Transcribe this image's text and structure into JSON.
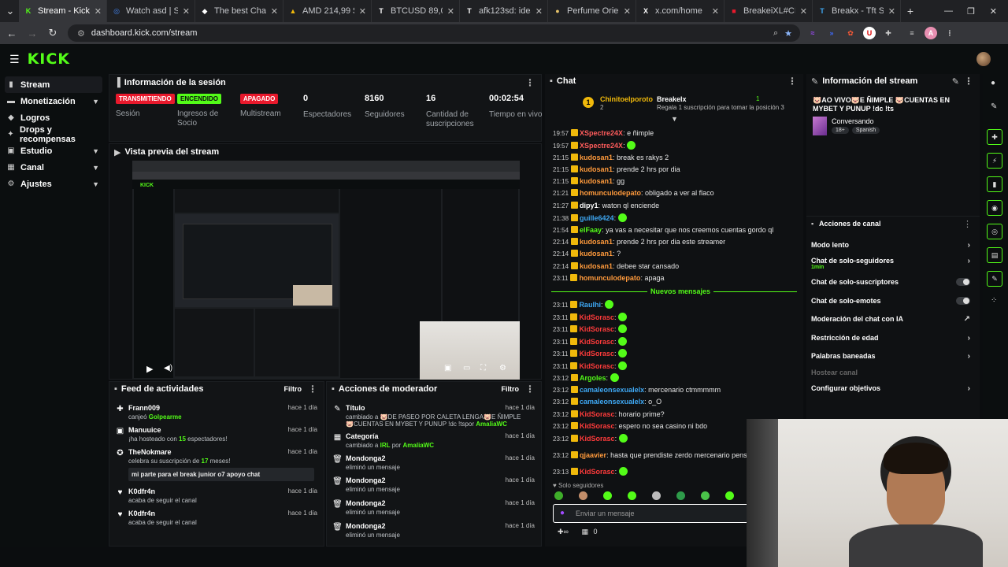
{
  "browser": {
    "tabs": [
      {
        "title": "Stream - Kick Dash",
        "color": "#53fc18",
        "glyph": "K",
        "active": true
      },
      {
        "title": "Watch asd | Strea",
        "color": "#4285f4",
        "glyph": "◎"
      },
      {
        "title": "The best ChatBot",
        "color": "#ffffff",
        "glyph": "◆"
      },
      {
        "title": "AMD 214,99 $ (▼",
        "color": "#f0b90b",
        "glyph": "▲"
      },
      {
        "title": "BTCUSD 89,093 ▲",
        "color": "#ffffff",
        "glyph": "T"
      },
      {
        "title": "afk123sd: ideas de",
        "color": "#ffffff",
        "glyph": "T"
      },
      {
        "title": "Perfume Oriental",
        "color": "#e6c36a",
        "glyph": "●"
      },
      {
        "title": "x.com/home",
        "color": "#ffffff",
        "glyph": "X"
      },
      {
        "title": "BreakeiXL#CIRDC",
        "color": "#e8192c",
        "glyph": "■"
      },
      {
        "title": "Breakx - Tft Stats",
        "color": "#3fa9f5",
        "glyph": "T"
      }
    ],
    "new_tab": "+",
    "url": "dashboard.kick.com/stream",
    "profile_letter": "A"
  },
  "kick": {
    "logo": "KICK"
  },
  "sidebar": {
    "items": [
      {
        "label": "Stream",
        "icon": "stream-icon",
        "glyph": "▮"
      },
      {
        "label": "Monetización",
        "icon": "money-icon",
        "glyph": "▬"
      },
      {
        "label": "Logros",
        "icon": "trophy-icon",
        "glyph": "◆"
      },
      {
        "label": "Drops y recompensas",
        "icon": "gift-icon",
        "glyph": "✦"
      },
      {
        "label": "Estudio",
        "icon": "studio-icon",
        "glyph": "▣"
      },
      {
        "label": "Canal",
        "icon": "channel-icon",
        "glyph": "▦"
      },
      {
        "label": "Ajustes",
        "icon": "gear-icon",
        "glyph": "⚙"
      }
    ]
  },
  "session": {
    "title": "Información de la sesión",
    "status": [
      {
        "badge": "TRANSMITIENDO",
        "label": "Sesión",
        "color": "red"
      },
      {
        "badge": "ENCENDIDO",
        "label": "Ingresos de Socio",
        "color": "green"
      },
      {
        "badge": "APAGADO",
        "label": "Multistream",
        "color": "red"
      }
    ],
    "stats": [
      {
        "value": "0",
        "label": "Espectadores"
      },
      {
        "value": "8160",
        "label": "Seguidores"
      },
      {
        "value": "16",
        "label": "Cantidad de suscripciones"
      },
      {
        "value": "00:02:54",
        "label": "Tiempo en vivo"
      }
    ]
  },
  "preview": {
    "title": "Vista previa del stream"
  },
  "activity": {
    "title": "Feed de actividades",
    "filter": "Filtro",
    "items": [
      {
        "name": "Frann009",
        "prefix": "canjeó ",
        "highlight": "Golpearme",
        "suffix": "",
        "when": "hace 1 día",
        "icon": "reward-icon"
      },
      {
        "name": "Manuuice",
        "prefix": "¡ha hosteado con ",
        "highlight": "15",
        "suffix": " espectadores!",
        "when": "hace 1 día",
        "icon": "host-icon"
      },
      {
        "name": "TheNokmare",
        "prefix": "celebra su suscripción de ",
        "highlight": "17",
        "suffix": " meses!",
        "when": "hace 1 día",
        "icon": "star-icon",
        "quote": "mi parte para el break junior o7 apoyo chat"
      },
      {
        "name": "K0dfr4n",
        "prefix": "acaba de seguir el canal",
        "highlight": "",
        "suffix": "",
        "when": "hace 1 día",
        "icon": "heart-icon"
      },
      {
        "name": "K0dfr4n",
        "prefix": "acaba de seguir el canal",
        "highlight": "",
        "suffix": "",
        "when": "hace 1 día",
        "icon": "heart-icon"
      }
    ]
  },
  "modactions": {
    "title": "Acciones de moderador",
    "filter": "Filtro",
    "items": [
      {
        "name": "Título",
        "desc": "cambiado a 🐷DE PASEO POR CALETA LENGA🐷E ÑIMPLE 🐷CUENTAS EN MYBET Y PUNUP !dc !ts",
        "by": "por ",
        "user": "AmaliaWC",
        "when": "hace 1 día",
        "icon": "title-icon"
      },
      {
        "name": "Categoría",
        "desc": "cambiado a ",
        "cat": "IRL",
        "by": " por ",
        "user": "AmaliaWC",
        "when": "hace 1 día",
        "icon": "category-icon"
      },
      {
        "name": "Mondonga2",
        "desc": "eliminó un mensaje",
        "when": "hace 1 día",
        "icon": "trash-icon"
      },
      {
        "name": "Mondonga2",
        "desc": "eliminó un mensaje",
        "when": "hace 1 día",
        "icon": "trash-icon"
      },
      {
        "name": "Mondonga2",
        "desc": "eliminó un mensaje",
        "when": "hace 1 día",
        "icon": "trash-icon"
      },
      {
        "name": "Mondonga2",
        "desc": "eliminó un mensaje",
        "when": "hace 1 día",
        "icon": "trash-icon"
      }
    ]
  },
  "chat": {
    "title": "Chat",
    "pinned": {
      "rank": "1",
      "user": "Chinitoelporoto",
      "count": "2",
      "target": "Breakelx",
      "target_count": "1",
      "text": "Regala 1 suscripción para tomar la posición 3"
    },
    "messages": [
      {
        "time": "19:57",
        "user": "XSpectre24X",
        "color": "#ff5c5c",
        "text": "e ñimple"
      },
      {
        "time": "19:57",
        "user": "XSpectre24X",
        "color": "#ff5c5c",
        "text": "",
        "emote": true
      },
      {
        "time": "21:15",
        "user": "kudosan1",
        "color": "#ff9a3c",
        "text": "break es rakys 2"
      },
      {
        "time": "21:15",
        "user": "kudosan1",
        "color": "#ff9a3c",
        "text": "prende 2 hrs por dia"
      },
      {
        "time": "21:15",
        "user": "kudosan1",
        "color": "#ff9a3c",
        "text": "gg"
      },
      {
        "time": "21:21",
        "user": "homunculodepato",
        "color": "#ff9a3c",
        "text": "obligado a ver al flaco"
      },
      {
        "time": "21:27",
        "user": "dipy1",
        "color": "#ffffff",
        "text": "waton ql enciende"
      },
      {
        "time": "21:38",
        "user": "guille6424",
        "color": "#3fa9f5",
        "text": "",
        "emote": true
      },
      {
        "time": "21:54",
        "user": "elFaay",
        "color": "#53fc18",
        "text": "ya vas a necesitar que nos creemos cuentas gordo ql"
      },
      {
        "time": "22:14",
        "user": "kudosan1",
        "color": "#ff9a3c",
        "text": "prende 2 hrs por dia este streamer"
      },
      {
        "time": "22:14",
        "user": "kudosan1",
        "color": "#ff9a3c",
        "text": "?"
      },
      {
        "time": "22:14",
        "user": "kudosan1",
        "color": "#ff9a3c",
        "text": "debee star cansado"
      },
      {
        "time": "23:11",
        "user": "homunculodepato",
        "color": "#ff9a3c",
        "text": "apaga"
      }
    ],
    "new_label": "Nuevos mensajes",
    "new_messages": [
      {
        "time": "23:11",
        "user": "Raulhi",
        "color": "#3fa9f5",
        "text": "",
        "emote": true
      },
      {
        "time": "23:11",
        "user": "KidSorasc",
        "color": "#ff3b3b",
        "text": "",
        "emote": true
      },
      {
        "time": "23:11",
        "user": "KidSorasc",
        "color": "#ff3b3b",
        "text": "",
        "emote": true
      },
      {
        "time": "23:11",
        "user": "KidSorasc",
        "color": "#ff3b3b",
        "text": "",
        "emote": true
      },
      {
        "time": "23:11",
        "user": "KidSorasc",
        "color": "#ff3b3b",
        "text": "",
        "emote": true
      },
      {
        "time": "23:11",
        "user": "KidSorasc",
        "color": "#ff3b3b",
        "text": "",
        "emote": true
      },
      {
        "time": "23:12",
        "user": "Argoles",
        "color": "#53fc18",
        "text": "",
        "emote": true
      },
      {
        "time": "23:12",
        "user": "camaleonsexualelx",
        "color": "#3fa9f5",
        "text": "mercenario ctmmmmm"
      },
      {
        "time": "23:12",
        "user": "camaleonsexualelx",
        "color": "#3fa9f5",
        "text": "o_O"
      },
      {
        "time": "23:12",
        "user": "KidSorasc",
        "color": "#ff3b3b",
        "text": "horario prime?"
      },
      {
        "time": "23:12",
        "user": "KidSorasc",
        "color": "#ff3b3b",
        "text": "espero no sea casino ni bdo"
      },
      {
        "time": "23:12",
        "user": "KidSorasc",
        "color": "#ff3b3b",
        "text": "",
        "emote": true
      },
      {
        "time": "23:12",
        "user": "qjaavier",
        "color": "#ff9a3c",
        "text": "hasta que prendiste zerdo mercenario pense que el agente buscar"
      },
      {
        "time": "23:13",
        "user": "KidSorasc",
        "color": "#ff3b3b",
        "text": "",
        "emote": true
      }
    ],
    "followers_only": "Solo seguidores",
    "input_placeholder": "Enviar un mensaje",
    "footer_count": "0"
  },
  "stream_info": {
    "title": "Información del stream",
    "stream_title": "🐷AO VIVO🐷E ÑIMPLE 🐷CUENTAS EN MYBET Y PUNUP !dc !ts",
    "category": "Conversando",
    "tags": [
      "18+",
      "Spanish"
    ]
  },
  "channel_actions": {
    "title": "Acciones de canal",
    "items": [
      {
        "label": "Modo lento",
        "type": "arrow"
      },
      {
        "label": "Chat de solo-seguidores",
        "sub": "1min",
        "type": "arrow"
      },
      {
        "label": "Chat de solo-suscriptores",
        "type": "toggle"
      },
      {
        "label": "Chat de solo-emotes",
        "type": "toggle"
      },
      {
        "label": "Moderación del chat con IA",
        "type": "ext"
      },
      {
        "label": "Restricción de edad",
        "type": "arrow"
      },
      {
        "label": "Palabras baneadas",
        "type": "arrow"
      },
      {
        "label": "Hostear canal",
        "type": "disabled"
      },
      {
        "label": "Configurar objetivos",
        "type": "arrow"
      }
    ]
  }
}
